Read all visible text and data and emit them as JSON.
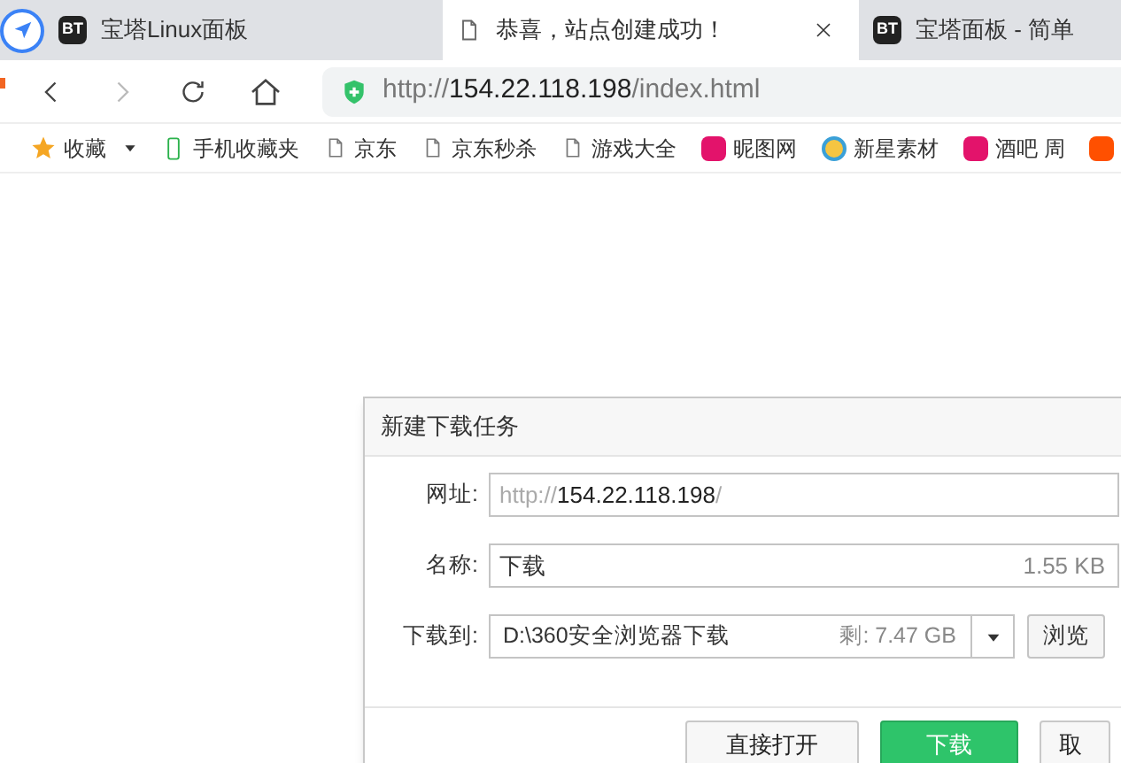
{
  "tabs": [
    {
      "kind": "bt",
      "logo": "BT",
      "title": "宝塔Linux面板",
      "selected": false
    },
    {
      "kind": "doc",
      "title": "恭喜，站点创建成功！",
      "selected": true
    },
    {
      "kind": "bt",
      "logo": "BT",
      "title": "宝塔面板 - 简单",
      "selected": false
    }
  ],
  "address": {
    "scheme": "http://",
    "host": "154.22.118.198",
    "path": "/index.html"
  },
  "bookmarks": [
    {
      "kind": "star",
      "label": "收藏"
    },
    {
      "kind": "phone",
      "label": "手机收藏夹"
    },
    {
      "kind": "doc",
      "label": "京东"
    },
    {
      "kind": "doc",
      "label": "京东秒杀"
    },
    {
      "kind": "doc",
      "label": "游戏大全"
    },
    {
      "kind": "ni",
      "label": "昵图网"
    },
    {
      "kind": "globe",
      "label": "新星素材"
    },
    {
      "kind": "ni",
      "label": "酒吧 周"
    },
    {
      "kind": "tao"
    }
  ],
  "dialog": {
    "title": "新建下载任务",
    "url": {
      "label": "网址:",
      "scheme": "http://",
      "host": "154.22.118.198",
      "tail": "/"
    },
    "name": {
      "label": "名称:",
      "value": "下载",
      "size": "1.55 KB"
    },
    "dest": {
      "label": "下载到:",
      "value": "D:\\360安全浏览器下载",
      "free": "剩: 7.47 GB",
      "browse": "浏览"
    },
    "buttons": [
      {
        "kind": "plain",
        "label": "直接打开"
      },
      {
        "kind": "primary",
        "label": "下载"
      },
      {
        "kind": "plain",
        "label": "取"
      }
    ]
  }
}
